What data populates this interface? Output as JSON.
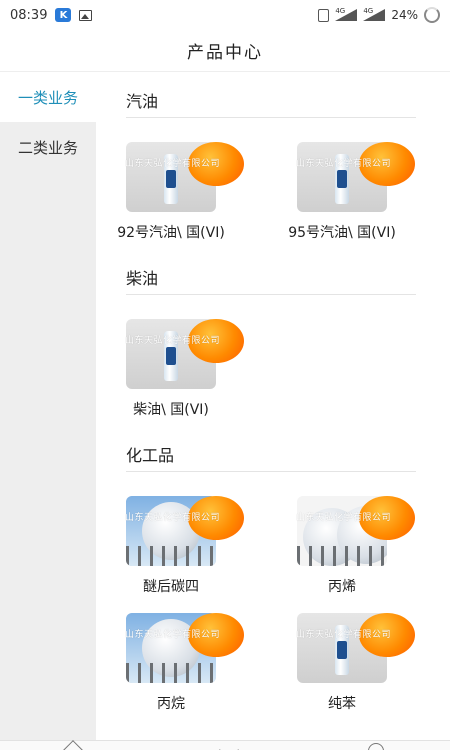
{
  "status_bar": {
    "time": "08:39",
    "app_badge": "K",
    "battery": "24%",
    "network_1": "4G",
    "network_2": "4G"
  },
  "header": {
    "title": "产品中心"
  },
  "sidebar": {
    "items": [
      {
        "label": "一类业务",
        "active": true
      },
      {
        "label": "二类业务",
        "active": false
      }
    ]
  },
  "sections": [
    {
      "title": "汽油",
      "products": [
        {
          "name": "92号汽油\\ 国(VI)",
          "image": "fuel-bottle"
        },
        {
          "name": "95号汽油\\ 国(VI)",
          "image": "fuel-bottle"
        }
      ]
    },
    {
      "title": "柴油",
      "products": [
        {
          "name": "柴油\\ 国(VI)",
          "image": "fuel-bottle"
        }
      ]
    },
    {
      "title": "化工品",
      "products": [
        {
          "name": "醚后碳四",
          "image": "sphere-tank"
        },
        {
          "name": "丙烯",
          "image": "sphere-tank"
        },
        {
          "name": "丙烷",
          "image": "sphere-tank"
        },
        {
          "name": "纯苯",
          "image": "fuel-bottle"
        }
      ]
    }
  ],
  "watermark_text": "山东天弘化学有限公司",
  "colors": {
    "accent": "#1f8fb8",
    "sidebar_bg": "#eeeeee",
    "badge": "#ff8a00"
  }
}
